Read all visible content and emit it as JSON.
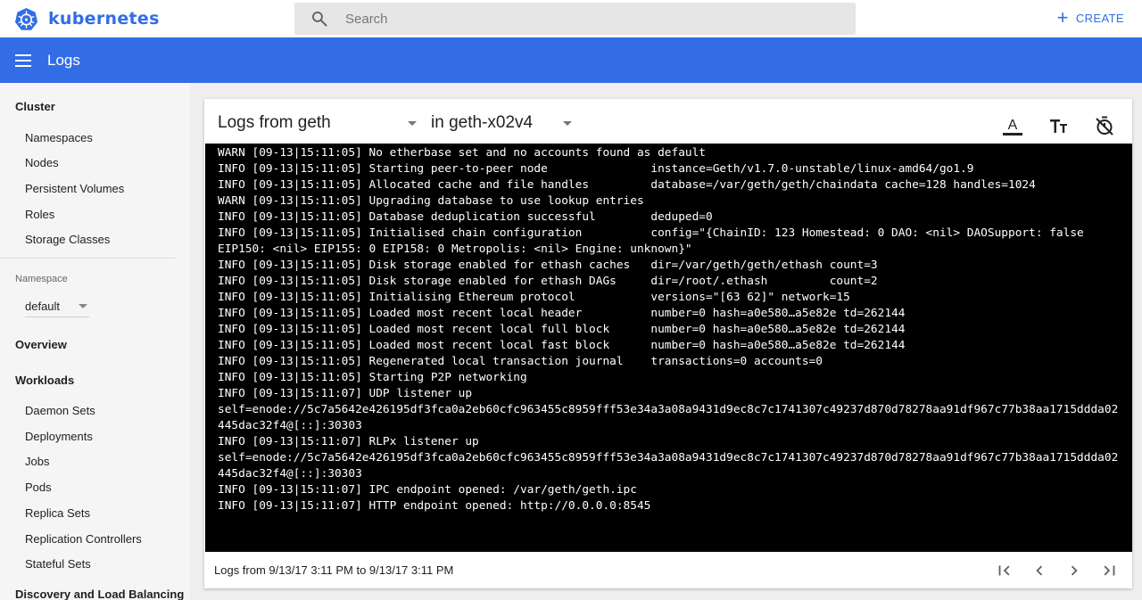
{
  "brand": {
    "name": "kubernetes"
  },
  "search": {
    "placeholder": "Search"
  },
  "header": {
    "create_label": "CREATE"
  },
  "appbar": {
    "title": "Logs"
  },
  "sidebar": {
    "cluster_heading": "Cluster",
    "cluster_items": [
      "Namespaces",
      "Nodes",
      "Persistent Volumes",
      "Roles",
      "Storage Classes"
    ],
    "namespace_label": "Namespace",
    "namespace_value": "default",
    "overview_heading": "Overview",
    "workloads_heading": "Workloads",
    "workload_items": [
      "Daemon Sets",
      "Deployments",
      "Jobs",
      "Pods",
      "Replica Sets",
      "Replication Controllers",
      "Stateful Sets"
    ],
    "discovery_heading": "Discovery and Load Balancing"
  },
  "logs": {
    "source_select": "Logs from geth",
    "container_select": "in geth-x02v4",
    "lines": [
      "WARN [09-13|15:11:05] No etherbase set and no accounts found as default",
      "INFO [09-13|15:11:05] Starting peer-to-peer node               instance=Geth/v1.7.0-unstable/linux-amd64/go1.9",
      "INFO [09-13|15:11:05] Allocated cache and file handles         database=/var/geth/geth/chaindata cache=128 handles=1024",
      "WARN [09-13|15:11:05] Upgrading database to use lookup entries",
      "INFO [09-13|15:11:05] Database deduplication successful        deduped=0",
      "INFO [09-13|15:11:05] Initialised chain configuration          config=\"{ChainID: 123 Homestead: 0 DAO: <nil> DAOSupport: false",
      "EIP150: <nil> EIP155: 0 EIP158: 0 Metropolis: <nil> Engine: unknown}\"",
      "INFO [09-13|15:11:05] Disk storage enabled for ethash caches   dir=/var/geth/geth/ethash count=3",
      "INFO [09-13|15:11:05] Disk storage enabled for ethash DAGs     dir=/root/.ethash         count=2",
      "INFO [09-13|15:11:05] Initialising Ethereum protocol           versions=\"[63 62]\" network=15",
      "INFO [09-13|15:11:05] Loaded most recent local header          number=0 hash=a0e580…a5e82e td=262144",
      "INFO [09-13|15:11:05] Loaded most recent local full block      number=0 hash=a0e580…a5e82e td=262144",
      "INFO [09-13|15:11:05] Loaded most recent local fast block      number=0 hash=a0e580…a5e82e td=262144",
      "INFO [09-13|15:11:05] Regenerated local transaction journal    transactions=0 accounts=0",
      "INFO [09-13|15:11:05] Starting P2P networking",
      "INFO [09-13|15:11:07] UDP listener up",
      "self=enode://5c7a5642e426195df3fca0a2eb60cfc963455c8959fff53e34a3a08a9431d9ec8c7c1741307c49237d870d78278aa91df967c77b38aa1715ddda02",
      "445dac32f4@[::]:30303",
      "INFO [09-13|15:11:07] RLPx listener up",
      "self=enode://5c7a5642e426195df3fca0a2eb60cfc963455c8959fff53e34a3a08a9431d9ec8c7c1741307c49237d870d78278aa91df967c77b38aa1715ddda02",
      "445dac32f4@[::]:30303",
      "INFO [09-13|15:11:07] IPC endpoint opened: /var/geth/geth.ipc",
      "INFO [09-13|15:11:07] HTTP endpoint opened: http://0.0.0.0:8545"
    ],
    "footer_text": "Logs from 9/13/17 3:11 PM to 9/13/17 3:11 PM"
  },
  "icons": {
    "logo": "kubernetes-helm-wheel-icon",
    "search": "search-icon",
    "create": "plus-icon",
    "menu": "hamburger-menu-icon",
    "text_color": "text-color-icon",
    "text_size": "text-size-icon",
    "timestamps": "timer-off-icon",
    "first": "first-page-icon",
    "prev": "chevron-left-icon",
    "next": "chevron-right-icon",
    "last": "last-page-icon"
  },
  "colors": {
    "accent": "#326de6",
    "log_background": "#000000",
    "log_text": "#ffffff",
    "sidebar": "#f5f5f5"
  }
}
